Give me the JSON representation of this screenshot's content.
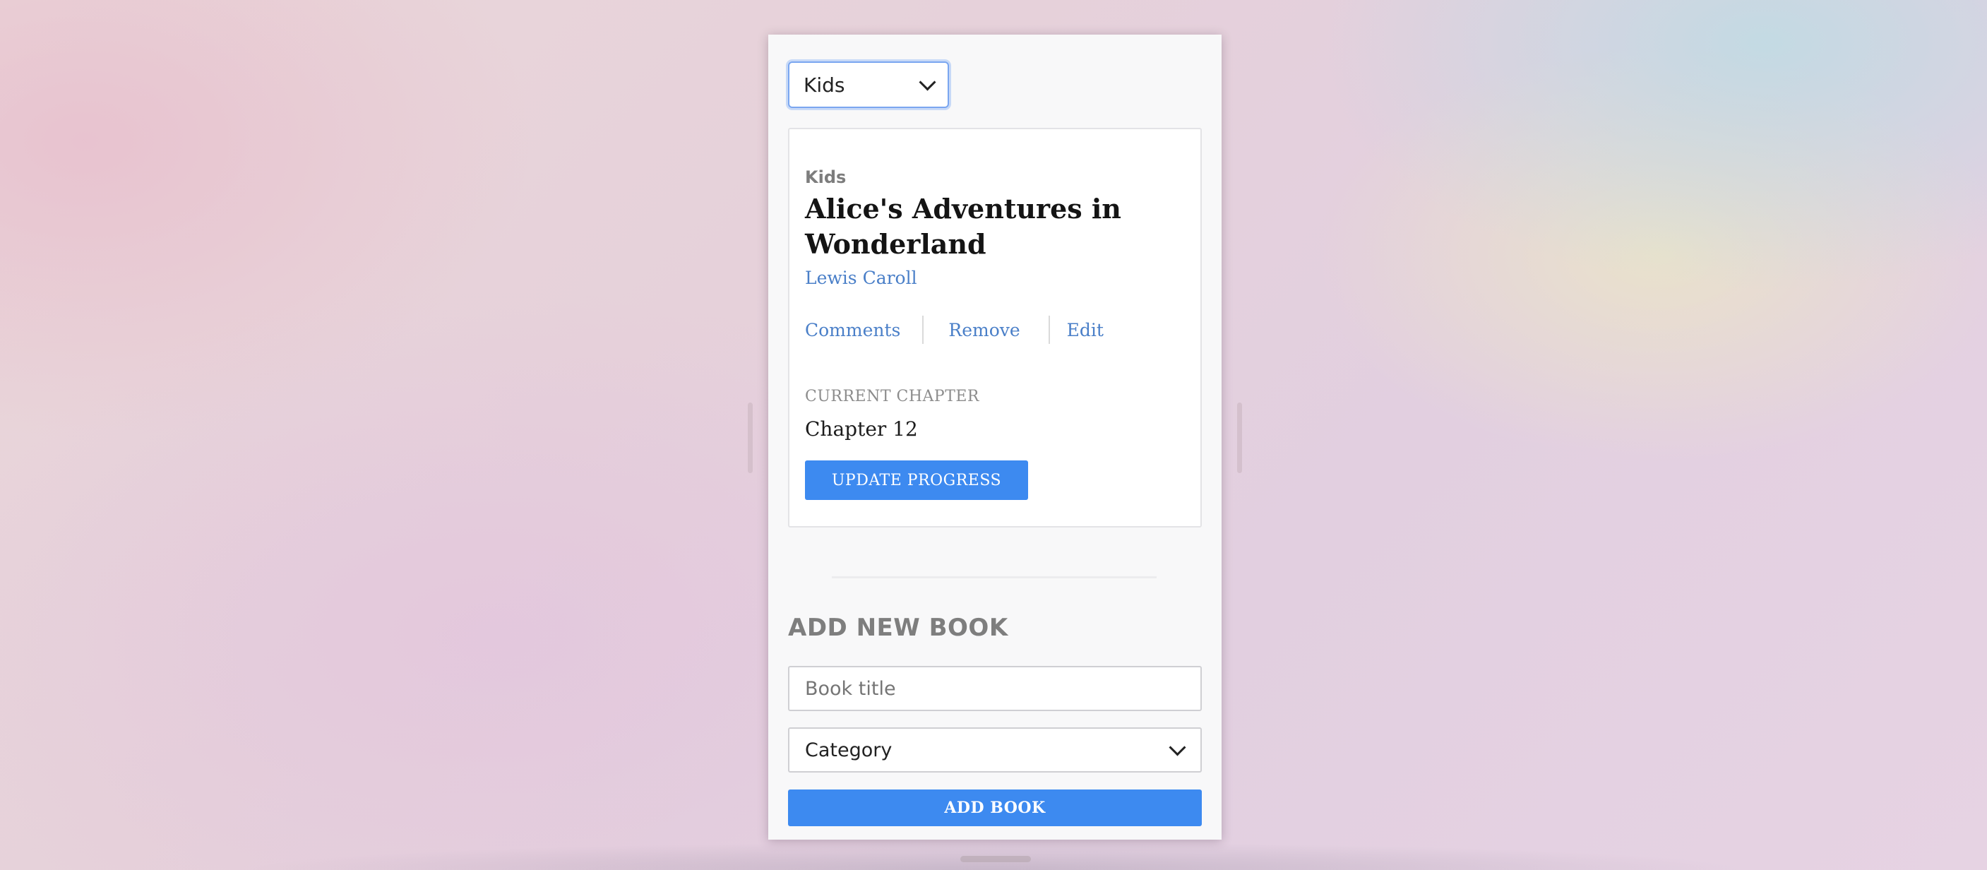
{
  "filter": {
    "selected": "Kids"
  },
  "book": {
    "category": "Kids",
    "title": "Alice's Adventures in Wonderland",
    "author": "Lewis Caroll",
    "actions": {
      "comments": "Comments",
      "remove": "Remove",
      "edit": "Edit"
    },
    "progress_label": "CURRENT CHAPTER",
    "progress_value": "Chapter 12",
    "update_button": "UPDATE PROGRESS"
  },
  "add_form": {
    "heading": "ADD NEW BOOK",
    "title_placeholder": "Book title",
    "category_selected": "Category",
    "submit_label": "ADD BOOK"
  },
  "colors": {
    "accent": "#3d8af0",
    "link": "#4a7fc8",
    "focus_ring": "#7aa6f0"
  },
  "icons": {
    "select_chevron": "chevron-down-icon"
  }
}
